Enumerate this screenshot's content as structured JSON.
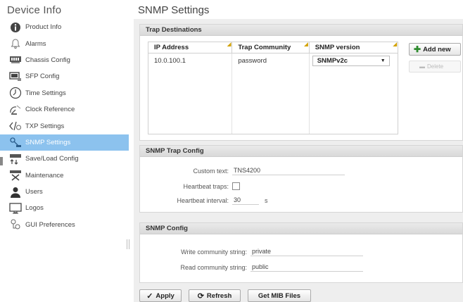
{
  "sidebar": {
    "title": "Device Info",
    "items": [
      {
        "label": "Product Info",
        "icon": "info-icon",
        "active": false
      },
      {
        "label": "Alarms",
        "icon": "bell-icon",
        "active": false
      },
      {
        "label": "Chassis Config",
        "icon": "chassis-icon",
        "active": false
      },
      {
        "label": "SFP Config",
        "icon": "sfp-icon",
        "active": false
      },
      {
        "label": "Time Settings",
        "icon": "clock-icon",
        "active": false
      },
      {
        "label": "Clock Reference",
        "icon": "satellite-dish-icon",
        "active": false
      },
      {
        "label": "TXP Settings",
        "icon": "code-tags-icon",
        "active": false
      },
      {
        "label": "SNMP Settings",
        "icon": "network-icon",
        "active": true
      },
      {
        "label": "Save/Load Config",
        "icon": "save-load-icon",
        "active": false
      },
      {
        "label": "Maintenance",
        "icon": "tools-icon",
        "active": false
      },
      {
        "label": "Users",
        "icon": "user-icon",
        "active": false
      },
      {
        "label": "Logos",
        "icon": "monitor-icon",
        "active": false
      },
      {
        "label": "GUI Preferences",
        "icon": "preferences-icon",
        "active": false
      }
    ]
  },
  "page_title": "SNMP Settings",
  "trap_destinations": {
    "header": "Trap Destinations",
    "columns": [
      "IP Address",
      "Trap Community",
      "SNMP version"
    ],
    "rows": [
      {
        "ip": "10.0.100.1",
        "community": "password",
        "version": "SNMPv2c"
      }
    ],
    "add_label": "Add new",
    "delete_label": "Delete"
  },
  "trap_config": {
    "header": "SNMP Trap Config",
    "custom_text_label": "Custom text:",
    "custom_text_value": "TNS4200",
    "heartbeat_traps_label": "Heartbeat traps:",
    "heartbeat_traps_checked": false,
    "heartbeat_interval_label": "Heartbeat interval:",
    "heartbeat_interval_value": "30",
    "heartbeat_interval_unit": "s"
  },
  "snmp_config": {
    "header": "SNMP Config",
    "write_label": "Write community string:",
    "write_value": "private",
    "read_label": "Read community string:",
    "read_value": "public"
  },
  "buttons": {
    "apply": "Apply",
    "refresh": "Refresh",
    "get_mib": "Get MIB Files"
  },
  "colors": {
    "active_item": "#8cc2ee",
    "add_icon": "#2e8b2e",
    "edit_marker": "#d2a100"
  }
}
